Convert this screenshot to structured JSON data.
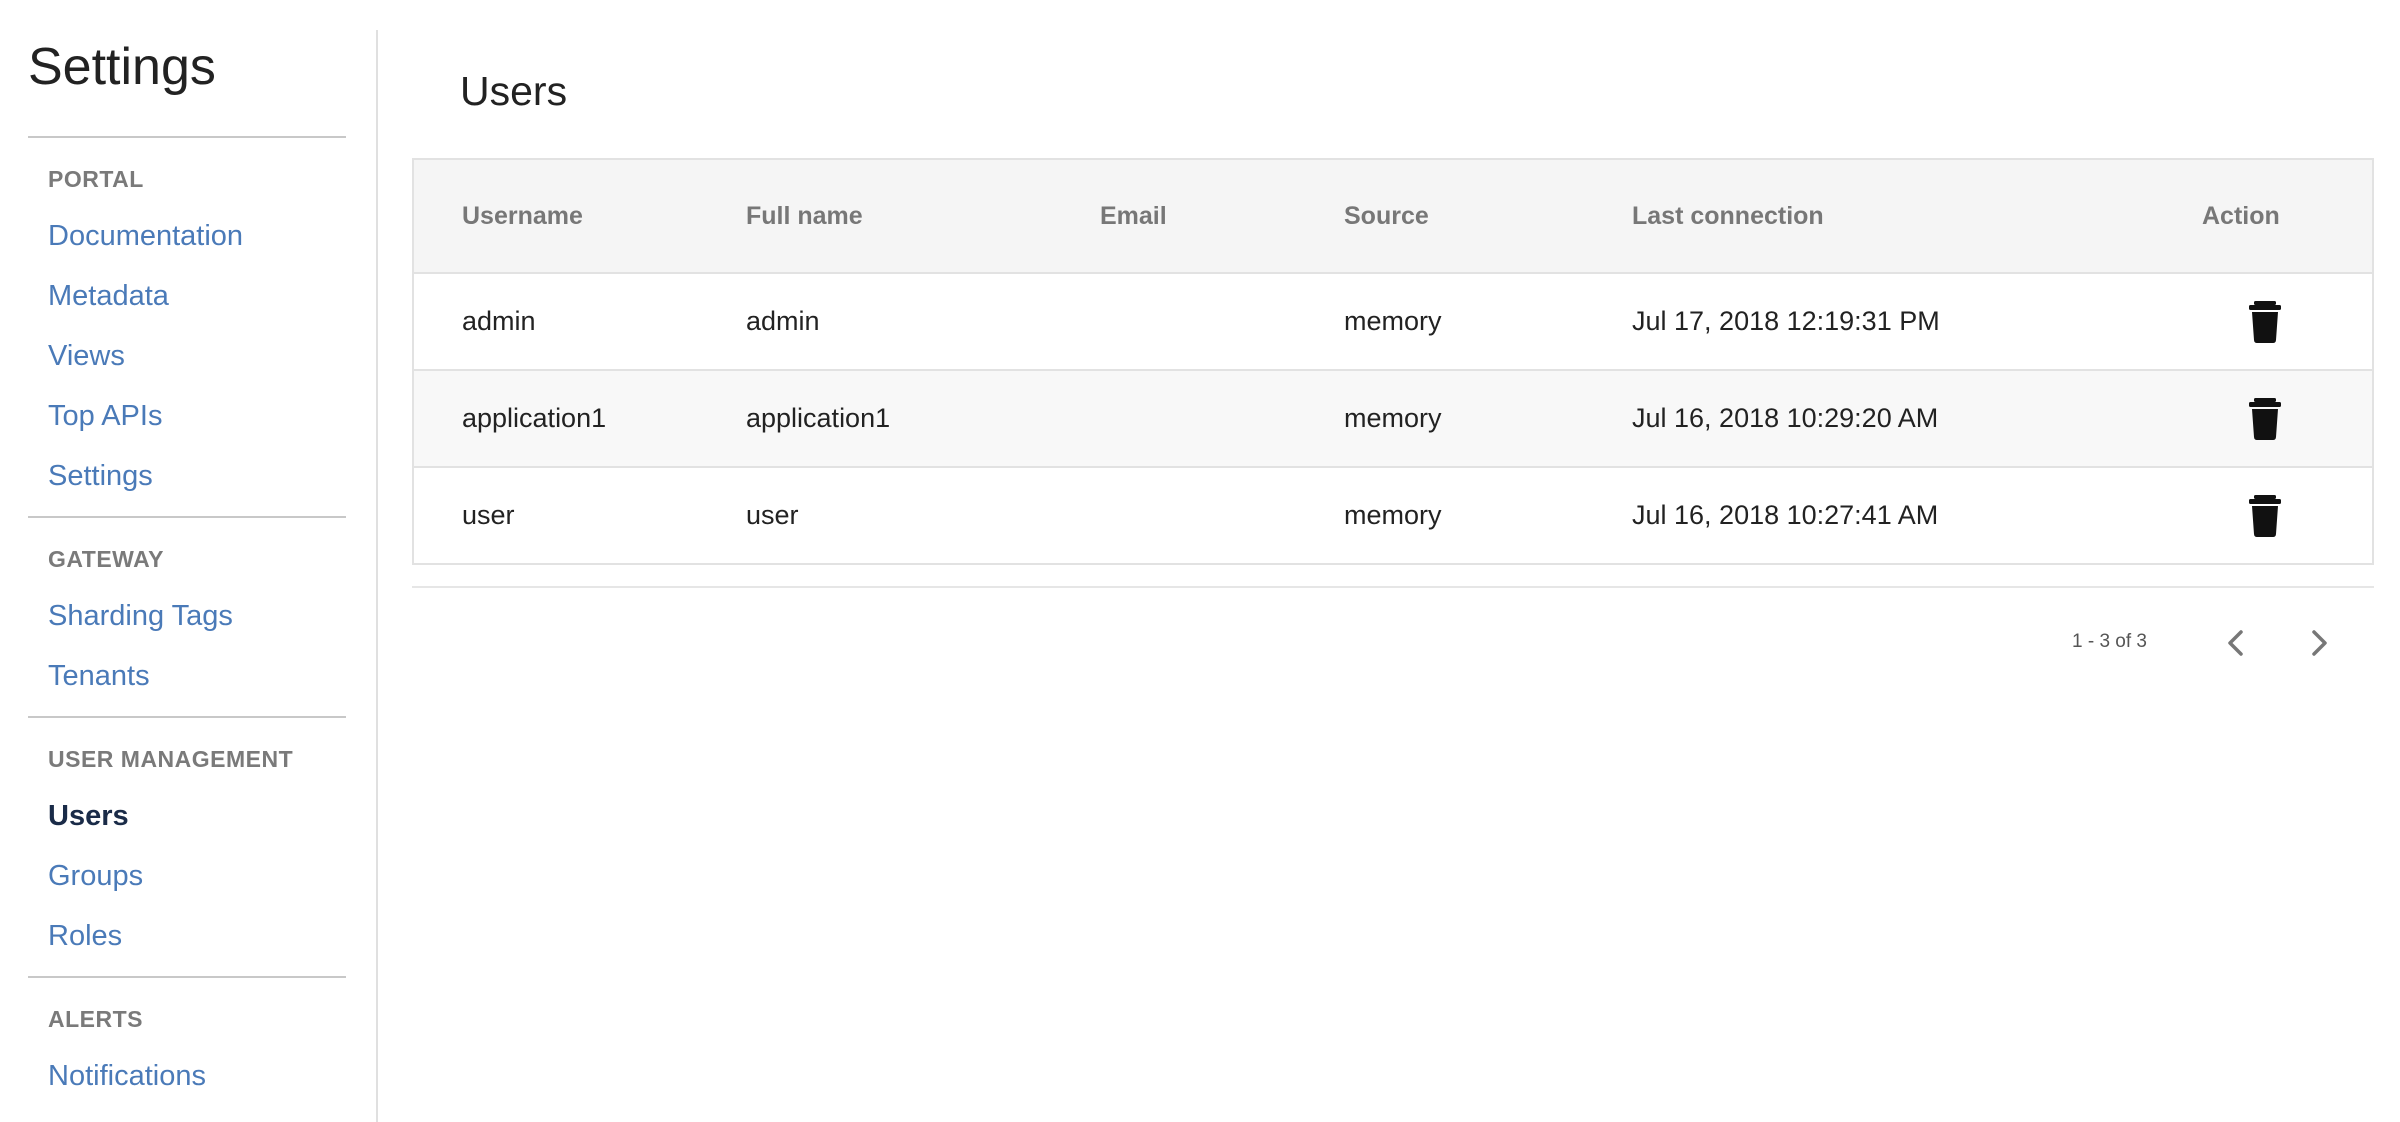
{
  "sidebar": {
    "title": "Settings",
    "sections": [
      {
        "header": "PORTAL",
        "items": [
          "Documentation",
          "Metadata",
          "Views",
          "Top APIs",
          "Settings"
        ]
      },
      {
        "header": "GATEWAY",
        "items": [
          "Sharding Tags",
          "Tenants"
        ]
      },
      {
        "header": "USER MANAGEMENT",
        "items": [
          "Users",
          "Groups",
          "Roles"
        ]
      },
      {
        "header": "ALERTS",
        "items": [
          "Notifications"
        ]
      }
    ],
    "active_item": "Users"
  },
  "main": {
    "title": "Users",
    "table": {
      "columns": [
        "Username",
        "Full name",
        "Email",
        "Source",
        "Last connection",
        "Action"
      ],
      "rows": [
        {
          "username": "admin",
          "full_name": "admin",
          "email": "",
          "source": "memory",
          "last_connection": "Jul 17, 2018 12:19:31 PM",
          "action_icon": "trash-icon"
        },
        {
          "username": "application1",
          "full_name": "application1",
          "email": "",
          "source": "memory",
          "last_connection": "Jul 16, 2018 10:29:20 AM",
          "action_icon": "trash-icon"
        },
        {
          "username": "user",
          "full_name": "user",
          "email": "",
          "source": "memory",
          "last_connection": "Jul 16, 2018 10:27:41 AM",
          "action_icon": "trash-icon"
        }
      ]
    },
    "pagination": {
      "range_text": "1 - 3 of 3",
      "prev_icon": "chevron-left-icon",
      "next_icon": "chevron-right-icon"
    }
  },
  "colors": {
    "link": "#4a7ab8",
    "active_link": "#1a2b48",
    "section_header": "#7a7a7a",
    "table_header_bg": "#f5f5f5",
    "icon": "#111111"
  }
}
